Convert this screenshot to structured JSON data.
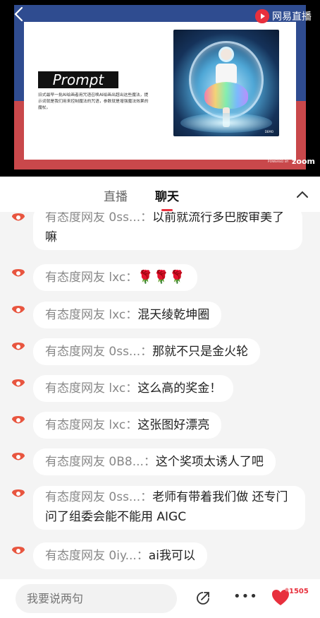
{
  "video": {
    "brand_name": "网易直播",
    "slide": {
      "heading": "Prompt",
      "description": "旧式最早一批AI绘画者用咒语召唤AI绘画出超出这些魔法，提示词就是我们用来控制魔法的咒语，参数就是增强魔法效果的魔杖。",
      "art_signature": "DEMO",
      "powered_by": "POWERED BY",
      "zoom_label": "zoom"
    }
  },
  "tabs": [
    {
      "label": "直播",
      "active": false
    },
    {
      "label": "聊天",
      "active": true
    }
  ],
  "messages": [
    {
      "nick": "有态度网友 0ss...",
      "text": "以前就流行多巴胺审美了嘛"
    },
    {
      "nick": "有态度网友 lxc",
      "text": "🌹🌹🌹"
    },
    {
      "nick": "有态度网友 lxc",
      "text": "混天绫乾坤圈"
    },
    {
      "nick": "有态度网友 0ss...",
      "text": "那就不只是金火轮"
    },
    {
      "nick": "有态度网友 lxc",
      "text": "这么高的奖金！"
    },
    {
      "nick": "有态度网友 lxc",
      "text": "这张图好漂亮"
    },
    {
      "nick": "有态度网友 0B8...",
      "text": "这个奖项太诱人了吧"
    },
    {
      "nick": "有态度网友 0ss...",
      "text": "老师有带着我们做 还专门问了组委会能不能用 AIGC"
    },
    {
      "nick": "有态度网友 0iy...",
      "text": "ai我可以"
    }
  ],
  "composer": {
    "placeholder": "我要说两句",
    "like_count": "1505"
  },
  "colors": {
    "accent": "#e8303d",
    "slide_blue": "#2f4c90",
    "slide_red": "#c9484b"
  }
}
